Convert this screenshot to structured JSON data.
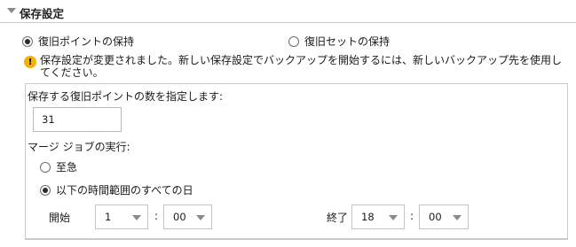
{
  "section": {
    "title": "保存設定"
  },
  "retention": {
    "option_recovery_points": "復旧ポイントの保持",
    "option_recovery_sets": "復旧セットの保持",
    "selected": "recovery_points"
  },
  "warning": {
    "icon": "warning-icon",
    "text": "保存設定が変更されました。新しい保存設定でバックアップを開始するには、新しいバックアップ先を使用してください。"
  },
  "points": {
    "label": "保存する復旧ポイントの数を指定します:",
    "value": "31"
  },
  "merge": {
    "label": "マージ ジョブの実行:",
    "option_immediate": "至急",
    "option_time_range": "以下の時間範囲のすべての日",
    "selected": "time_range"
  },
  "schedule": {
    "start_label": "開始",
    "start_hour": "1",
    "start_minute": "00",
    "end_label": "終了",
    "end_hour": "18",
    "end_minute": "00",
    "separator": ":"
  },
  "colors": {
    "warning": "#f0b400",
    "border": "#c9c9c9"
  }
}
